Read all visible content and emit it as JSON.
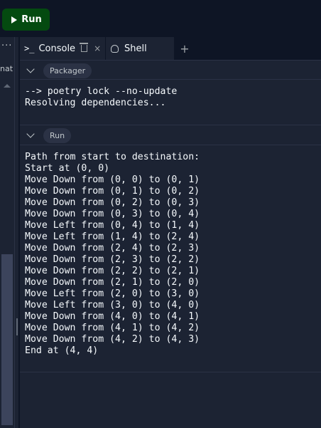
{
  "toolbar": {
    "run_label": "Run"
  },
  "left_panel": {
    "menu_label": "···",
    "truncated_label": "nat"
  },
  "tabs": {
    "console_prompt": ">_",
    "console_label": "Console",
    "close_symbol": "×",
    "shell_label": "Shell",
    "add_symbol": "+"
  },
  "packager": {
    "pill": "Packager",
    "lines": [
      "--> poetry lock --no-update",
      "Resolving dependencies..."
    ]
  },
  "run_section": {
    "pill": "Run",
    "lines": [
      "Path from start to destination:",
      "Start at (0, 0)",
      "Move Down from (0, 0) to (0, 1)",
      "Move Down from (0, 1) to (0, 2)",
      "Move Down from (0, 2) to (0, 3)",
      "Move Down from (0, 3) to (0, 4)",
      "Move Left from (0, 4) to (1, 4)",
      "Move Left from (1, 4) to (2, 4)",
      "Move Down from (2, 4) to (2, 3)",
      "Move Down from (2, 3) to (2, 2)",
      "Move Down from (2, 2) to (2, 1)",
      "Move Down from (2, 1) to (2, 0)",
      "Move Left from (2, 0) to (3, 0)",
      "Move Left from (3, 0) to (4, 0)",
      "Move Down from (4, 0) to (4, 1)",
      "Move Down from (4, 1) to (4, 2)",
      "Move Down from (4, 2) to (4, 3)",
      "End at (4, 4)"
    ]
  },
  "icons": {
    "run": "play-icon",
    "console": "terminal-prompt-icon",
    "clear": "trash-icon",
    "close": "close-icon",
    "shell": "shell-icon",
    "add": "plus-icon",
    "collapse": "chevron-down-icon"
  },
  "colors": {
    "background": "#1c2333",
    "topbar": "#0e1525",
    "run_button": "#044a10",
    "text": "#f5f9fc",
    "pill": "#2b3245"
  }
}
